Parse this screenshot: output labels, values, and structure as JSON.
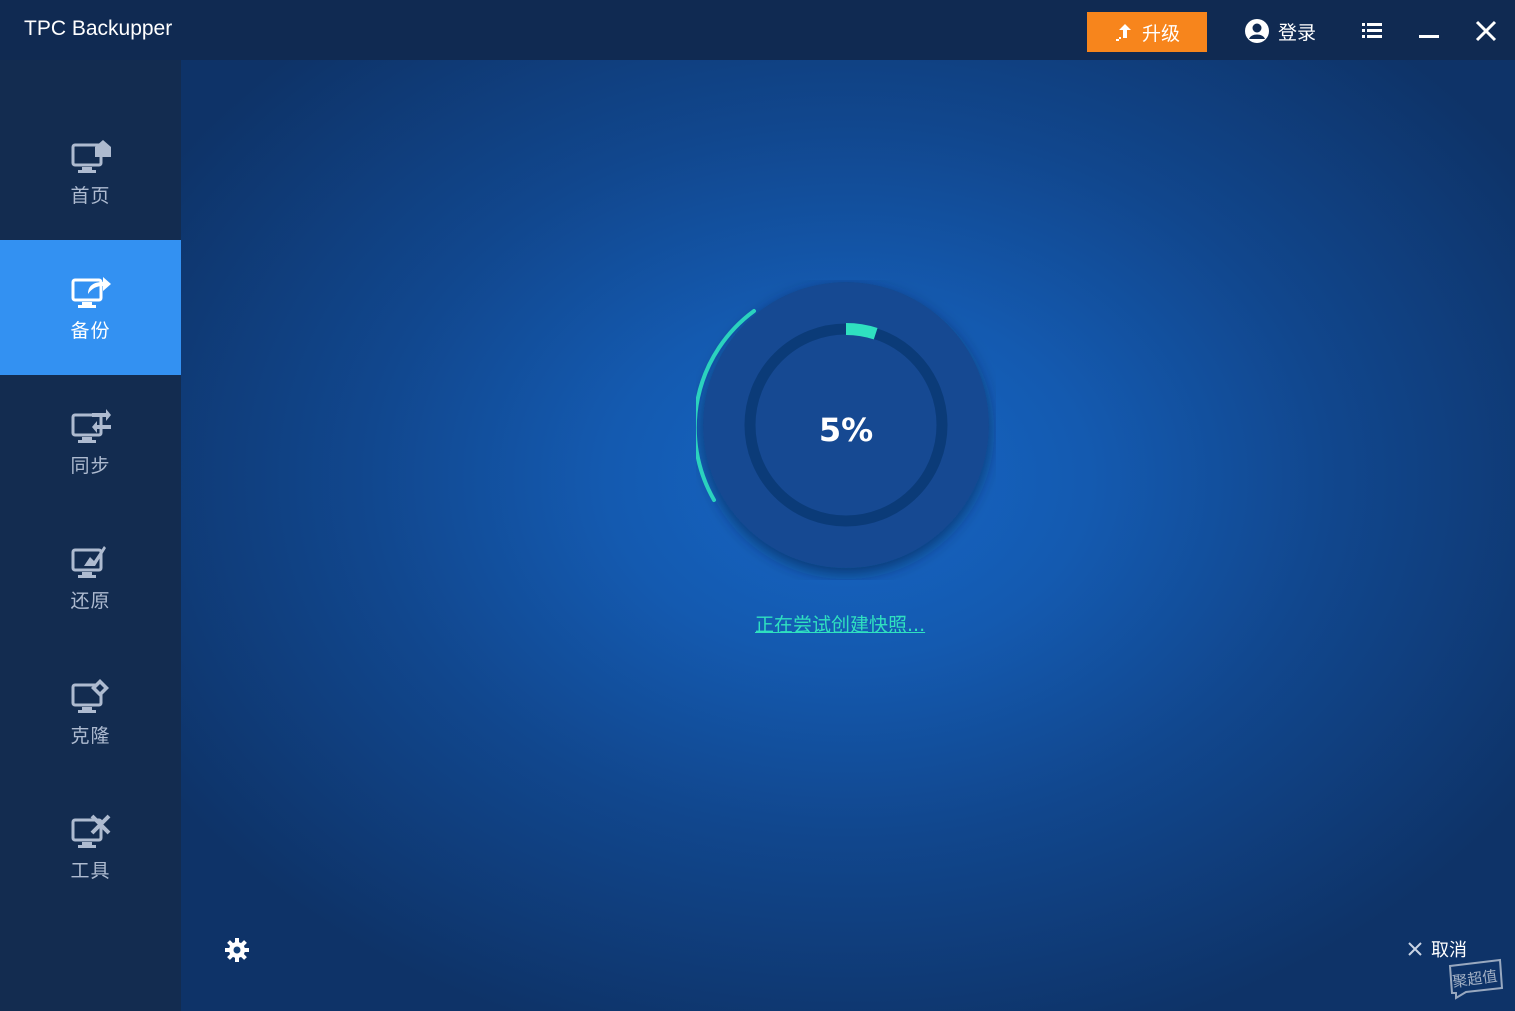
{
  "app": {
    "title": "TPC Backupper"
  },
  "titlebar": {
    "upgrade_label": "升级",
    "login_label": "登录"
  },
  "sidebar": {
    "items": [
      {
        "label": "首页",
        "icon": "home-monitor-icon",
        "active": false
      },
      {
        "label": "备份",
        "icon": "backup-monitor-icon",
        "active": true
      },
      {
        "label": "同步",
        "icon": "sync-monitor-icon",
        "active": false
      },
      {
        "label": "还原",
        "icon": "restore-monitor-icon",
        "active": false
      },
      {
        "label": "克隆",
        "icon": "clone-monitor-icon",
        "active": false
      },
      {
        "label": "工具",
        "icon": "tools-monitor-icon",
        "active": false
      }
    ]
  },
  "main": {
    "progress": {
      "value": 5,
      "text": "5%"
    },
    "status_text": "正在尝试创建快照...",
    "cancel_label": "取消",
    "watermark_text": "聚超值"
  },
  "colors": {
    "accent": "#f7851c",
    "active_nav": "#3391f2",
    "progress": "#2fe0c0"
  }
}
